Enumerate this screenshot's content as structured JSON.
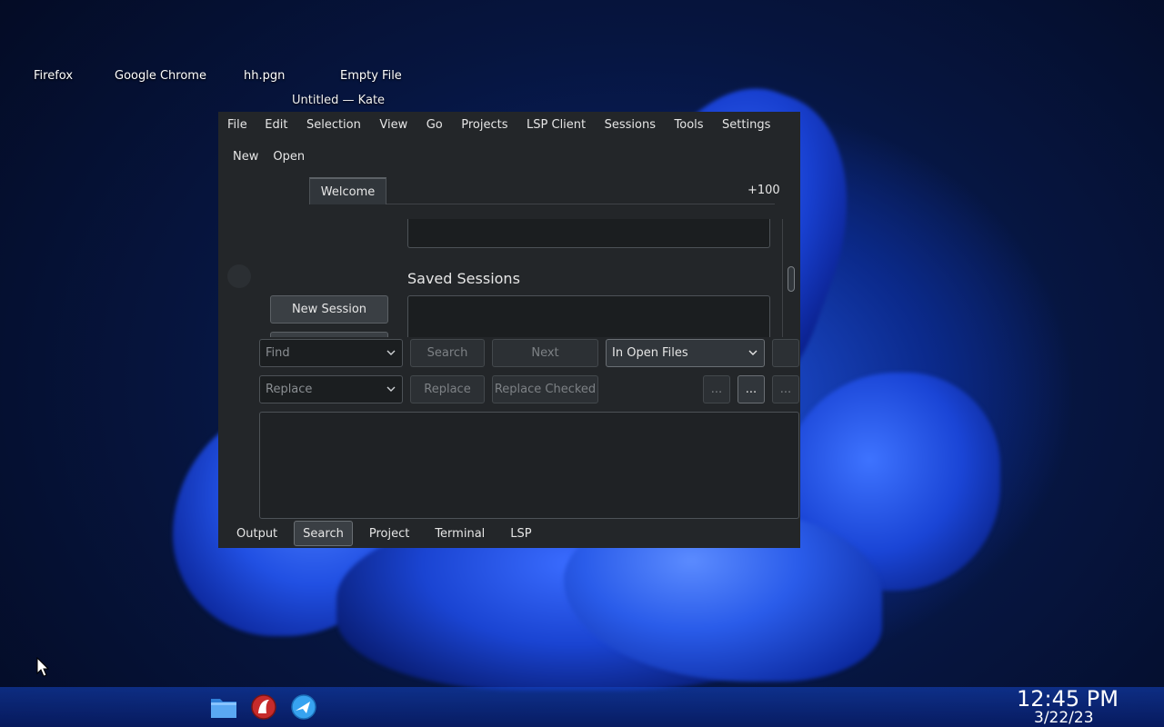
{
  "desktop": {
    "icons": [
      "Firefox",
      "Google Chrome",
      "hh.pgn",
      "Empty File"
    ]
  },
  "window": {
    "title": "Untitled — Kate",
    "menu": [
      "File",
      "Edit",
      "Selection",
      "View",
      "Go",
      "Projects",
      "LSP Client",
      "Sessions",
      "Tools",
      "Settings"
    ],
    "toolbar": [
      "New",
      "Open"
    ],
    "tab": "Welcome",
    "tab_extra": "+100",
    "welcome": {
      "saved_sessions_title": "Saved Sessions",
      "new_session_label": "New Session"
    },
    "search": {
      "find_placeholder": "Find",
      "search_label": "Search",
      "next_label": "Next",
      "scope": "In Open Files",
      "replace_placeholder": "Replace",
      "replace_label": "Replace",
      "replace_checked_label": "Replace Checked",
      "more_label": "..."
    },
    "bottom_tabs": [
      "Output",
      "Search",
      "Project",
      "Terminal",
      "LSP"
    ],
    "active_bottom_tab": "Search"
  },
  "taskbar": {
    "icons": [
      "folder-icon",
      "kate-icon",
      "browser-icon"
    ],
    "time": "12:45 PM",
    "date": "3/22/23"
  },
  "colors": {
    "window_bg": "#232629",
    "accent_wallpaper": "#1a45d6"
  }
}
